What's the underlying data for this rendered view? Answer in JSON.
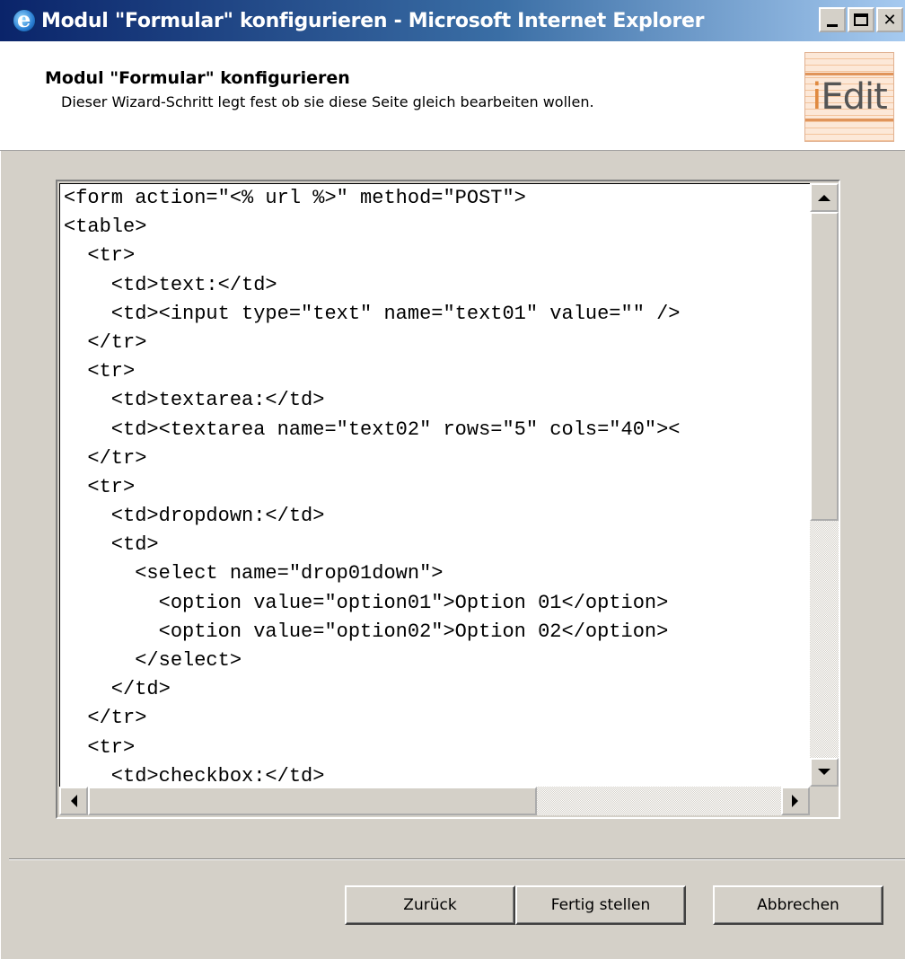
{
  "window": {
    "title": "Modul \"Formular\" konfigurieren - Microsoft Internet Explorer",
    "controls": [
      "minimize",
      "maximize",
      "close"
    ]
  },
  "header": {
    "title": "Modul \"Formular\" konfigurieren",
    "subtitle": "Dieser Wizard-Schritt legt fest ob sie diese Seite gleich bearbeiten wollen.",
    "logo_prefix": "i",
    "logo_suffix": "Edit"
  },
  "editor": {
    "lines": [
      "<form action=\"<% url %>\" method=\"POST\">",
      "<table>",
      "  <tr>",
      "    <td>text:</td>",
      "    <td><input type=\"text\" name=\"text01\" value=\"\" />",
      "  </tr>",
      "  <tr>",
      "    <td>textarea:</td>",
      "    <td><textarea name=\"text02\" rows=\"5\" cols=\"40\"><",
      "  </tr>",
      "  <tr>",
      "    <td>dropdown:</td>",
      "    <td>",
      "      <select name=\"drop01down\">",
      "        <option value=\"option01\">Option 01</option>",
      "        <option value=\"option02\">Option 02</option>",
      "      </select>",
      "    </td>",
      "  </tr>",
      "  <tr>",
      "    <td>checkbox:</td>"
    ]
  },
  "buttons": {
    "back": "Zurück",
    "finish": "Fertig stellen",
    "cancel": "Abbrechen"
  },
  "colors": {
    "titlebar_start": "#0a246a",
    "titlebar_end": "#a6caf0",
    "dialog_bg": "#d4d0c8",
    "logo_accent": "#e08a40"
  }
}
